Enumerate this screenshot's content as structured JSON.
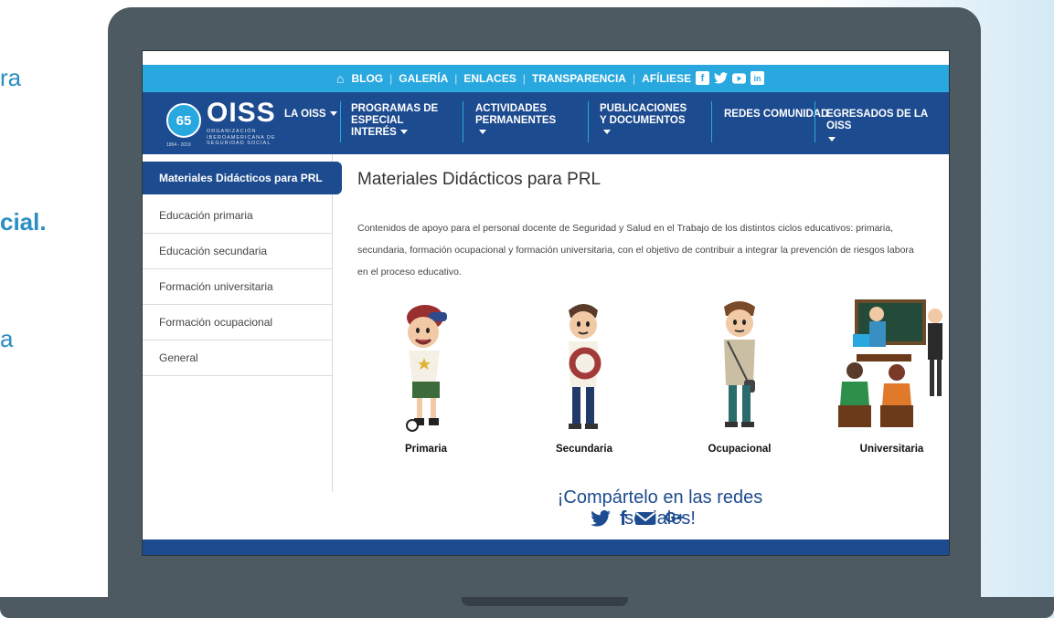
{
  "background_text": [
    "ra",
    "cial.",
    "a"
  ],
  "topbar": {
    "links": [
      "BLOG",
      "GALERÍA",
      "ENLACES",
      "TRANSPARENCIA",
      "AFÍLIESE"
    ],
    "social_icons": [
      "facebook-icon",
      "twitter-icon",
      "youtube-icon",
      "linkedin-icon"
    ],
    "colors": {
      "bar": "#29a8df"
    }
  },
  "logo": {
    "name": "OISS",
    "subtitle": "ORGANIZACIÓN IBEROAMERICANA DE SEGURIDAD SOCIAL",
    "years": "1954 - 2019",
    "badge": "65"
  },
  "nav": {
    "items": [
      {
        "label": "LA OISS",
        "dropdown": true
      },
      {
        "label": "PROGRAMAS DE ESPECIAL INTERÉS",
        "dropdown": true
      },
      {
        "label": "ACTIVIDADES PERMANENTES",
        "dropdown": true
      },
      {
        "label": "PUBLICACIONES Y DOCUMENTOS",
        "dropdown": true
      },
      {
        "label": "REDES COMUNIDAD",
        "dropdown": false
      },
      {
        "label": "EGRESADOS DE LA OISS",
        "dropdown": true
      }
    ],
    "colors": {
      "bar": "#1d4b8f"
    }
  },
  "sidebar": {
    "active": "Materiales Didácticos para PRL",
    "items": [
      "Educación primaria",
      "Educación secundaria",
      "Formación universitaria",
      "Formación ocupacional",
      "General"
    ]
  },
  "main": {
    "title": "Materiales Didácticos para PRL",
    "description_lines": [
      "Contenidos de apoyo para el personal docente de Seguridad y Salud en el Trabajo de los distintos ciclos educativos: primaria,",
      "secundaria, formación ocupacional y formación universitaria, con el objetivo de contribuir a integrar la prevención de riesgos labora",
      "en el proceso educativo."
    ],
    "cards": [
      "Primaria",
      "Secundaria",
      "Ocupacional",
      "Universitaria"
    ]
  },
  "share": {
    "title": "¡Compártelo en las redes sociales!",
    "icons": [
      "twitter-icon",
      "facebook-icon",
      "email-icon",
      "google-plus-icon"
    ]
  }
}
